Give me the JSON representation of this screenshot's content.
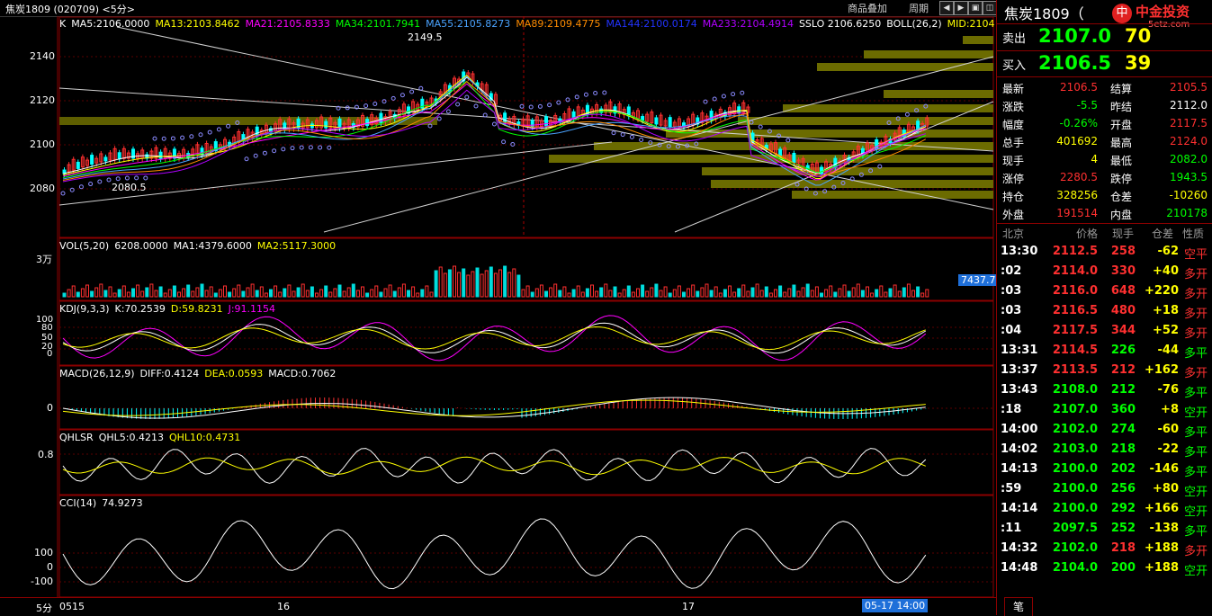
{
  "window": {
    "title": "焦炭1809 (020709) <5分>",
    "menu_overlay": "商品叠加",
    "menu_period": "周期"
  },
  "main_chart": {
    "indicator_line": [
      {
        "text": "K",
        "color": "#ffffff"
      },
      {
        "text": "MA5:2106.0000",
        "color": "#ffffff"
      },
      {
        "text": "MA13:2103.8462",
        "color": "#ffff00"
      },
      {
        "text": "MA21:2105.8333",
        "color": "#ff00ff"
      },
      {
        "text": "MA34:2101.7941",
        "color": "#00ff00"
      },
      {
        "text": "MA55:2105.8273",
        "color": "#4aa3ff"
      },
      {
        "text": "MA89:2109.4775",
        "color": "#ff8c00"
      },
      {
        "text": "MA144:2100.0174",
        "color": "#2233ff"
      },
      {
        "text": "MA233:2104.4914",
        "color": "#b000ff"
      },
      {
        "text": "SSLO 2106.6250",
        "color": "#ffffff"
      },
      {
        "text": "BOLL(26,2)",
        "color": "#ffffff"
      },
      {
        "text": "MID:2104",
        "color": "#ffff00"
      }
    ],
    "y_ticks": [
      "2140",
      "2120",
      "2100",
      "2080"
    ],
    "high_label": "2149.5",
    "low_label": "2080.5"
  },
  "volume_panel": {
    "title": "VOL(5,20)",
    "values": [
      {
        "text": "6208.0000",
        "color": "#ffffff"
      },
      {
        "text": "MA1:4379.6000",
        "color": "#ffffff"
      },
      {
        "text": "MA2:5117.3000",
        "color": "#ffff00"
      }
    ],
    "y_label": "3万",
    "badge": "7437.7"
  },
  "kdj_panel": {
    "title": "KDJ(9,3,3)",
    "values": [
      {
        "text": "K:70.2539",
        "color": "#ffffff"
      },
      {
        "text": "D:59.8231",
        "color": "#ffff00"
      },
      {
        "text": "J:91.1154",
        "color": "#ff00ff"
      }
    ],
    "y_ticks": [
      "100",
      "80",
      "50",
      "20",
      "0"
    ]
  },
  "macd_panel": {
    "title": "MACD(26,12,9)",
    "values": [
      {
        "text": "DIFF:0.4124",
        "color": "#ffffff"
      },
      {
        "text": "DEA:0.0593",
        "color": "#ffff00"
      },
      {
        "text": "MACD:0.7062",
        "color": "#ffffff"
      }
    ],
    "y_ticks": [
      "0"
    ]
  },
  "qhl_panel": {
    "title": "QHLSR",
    "values": [
      {
        "text": "QHL5:0.4213",
        "color": "#ffffff"
      },
      {
        "text": "QHL10:0.4731",
        "color": "#ffff00"
      }
    ],
    "y_ticks": [
      "0.8"
    ]
  },
  "cci_panel": {
    "title": "CCI(14)",
    "values": [
      {
        "text": "74.9273",
        "color": "#ffffff"
      }
    ],
    "y_ticks": [
      "100",
      "0",
      "-100"
    ]
  },
  "time_axis": {
    "period": "5分",
    "labels": [
      "0515",
      "16",
      "17"
    ],
    "cursor_label": "05-17 14:00"
  },
  "right_panel": {
    "title": "焦炭1809（",
    "logo_text": "中金投资",
    "logo_sub": "5etz.com",
    "ask": {
      "label": "卖出",
      "price": "2107.0",
      "vol": "70"
    },
    "bid": {
      "label": "买入",
      "price": "2106.5",
      "vol": "39"
    },
    "stats": [
      {
        "l1": "最新",
        "v1": "2106.5",
        "c1": "#ff3030",
        "l2": "结算",
        "v2": "2105.5",
        "c2": "#ff3030"
      },
      {
        "l1": "涨跌",
        "v1": "-5.5",
        "c1": "#00ff00",
        "l2": "昨结",
        "v2": "2112.0",
        "c2": "#ffffff"
      },
      {
        "l1": "幅度",
        "v1": "-0.26%",
        "c1": "#00ff00",
        "l2": "开盘",
        "v2": "2117.5",
        "c2": "#ff3030"
      },
      {
        "l1": "总手",
        "v1": "401692",
        "c1": "#ffff00",
        "l2": "最高",
        "v2": "2124.0",
        "c2": "#ff3030"
      },
      {
        "l1": "现手",
        "v1": "4",
        "c1": "#ffff00",
        "l2": "最低",
        "v2": "2082.0",
        "c2": "#00ff00"
      },
      {
        "l1": "涨停",
        "v1": "2280.5",
        "c1": "#ff3030",
        "l2": "跌停",
        "v2": "1943.5",
        "c2": "#00ff00"
      },
      {
        "l1": "持仓",
        "v1": "328256",
        "c1": "#ffff00",
        "l2": "仓差",
        "v2": "-10260",
        "c2": "#ffff00"
      },
      {
        "l1": "外盘",
        "v1": "191514",
        "c1": "#ff3030",
        "l2": "内盘",
        "v2": "210178",
        "c2": "#00ff00"
      }
    ],
    "trade_headers": [
      "北京",
      "价格",
      "现手",
      "仓差",
      "性质"
    ],
    "trades": [
      {
        "time": "13:30",
        "price": "2112.5",
        "pc": "#ff3030",
        "vol": "258",
        "vc": "#ff3030",
        "diff": "-62",
        "nature": "空平",
        "nc": "#ff3030"
      },
      {
        "time": ":02",
        "price": "2114.0",
        "pc": "#ff3030",
        "vol": "330",
        "vc": "#ff3030",
        "diff": "+40",
        "nature": "多开",
        "nc": "#ff3030"
      },
      {
        "time": ":03",
        "price": "2116.0",
        "pc": "#ff3030",
        "vol": "648",
        "vc": "#ff3030",
        "diff": "+220",
        "nature": "多开",
        "nc": "#ff3030"
      },
      {
        "time": ":03",
        "price": "2116.5",
        "pc": "#ff3030",
        "vol": "480",
        "vc": "#ff3030",
        "diff": "+18",
        "nature": "多开",
        "nc": "#ff3030"
      },
      {
        "time": ":04",
        "price": "2117.5",
        "pc": "#ff3030",
        "vol": "344",
        "vc": "#ff3030",
        "diff": "+52",
        "nature": "多开",
        "nc": "#ff3030"
      },
      {
        "time": "13:31",
        "price": "2114.5",
        "pc": "#ff3030",
        "vol": "226",
        "vc": "#00ff00",
        "diff": "-44",
        "nature": "多平",
        "nc": "#00ff00"
      },
      {
        "time": "13:37",
        "price": "2113.5",
        "pc": "#ff3030",
        "vol": "212",
        "vc": "#ff3030",
        "diff": "+162",
        "nature": "多开",
        "nc": "#ff3030"
      },
      {
        "time": "13:43",
        "price": "2108.0",
        "pc": "#00ff00",
        "vol": "212",
        "vc": "#00ff00",
        "diff": "-76",
        "nature": "多平",
        "nc": "#00ff00"
      },
      {
        "time": ":18",
        "price": "2107.0",
        "pc": "#00ff00",
        "vol": "360",
        "vc": "#00ff00",
        "diff": "+8",
        "nature": "空开",
        "nc": "#00ff00"
      },
      {
        "time": "14:00",
        "price": "2102.0",
        "pc": "#00ff00",
        "vol": "274",
        "vc": "#00ff00",
        "diff": "-60",
        "nature": "多平",
        "nc": "#00ff00"
      },
      {
        "time": "14:02",
        "price": "2103.0",
        "pc": "#00ff00",
        "vol": "218",
        "vc": "#00ff00",
        "diff": "-22",
        "nature": "多平",
        "nc": "#00ff00"
      },
      {
        "time": "14:13",
        "price": "2100.0",
        "pc": "#00ff00",
        "vol": "202",
        "vc": "#00ff00",
        "diff": "-146",
        "nature": "多平",
        "nc": "#00ff00"
      },
      {
        "time": ":59",
        "price": "2100.0",
        "pc": "#00ff00",
        "vol": "256",
        "vc": "#00ff00",
        "diff": "+80",
        "nature": "空开",
        "nc": "#00ff00"
      },
      {
        "time": "14:14",
        "price": "2100.0",
        "pc": "#00ff00",
        "vol": "292",
        "vc": "#00ff00",
        "diff": "+166",
        "nature": "空开",
        "nc": "#00ff00"
      },
      {
        "time": ":11",
        "price": "2097.5",
        "pc": "#00ff00",
        "vol": "252",
        "vc": "#00ff00",
        "diff": "-138",
        "nature": "多平",
        "nc": "#00ff00"
      },
      {
        "time": "14:32",
        "price": "2102.0",
        "pc": "#00ff00",
        "vol": "218",
        "vc": "#ff3030",
        "diff": "+188",
        "nature": "多开",
        "nc": "#ff3030"
      },
      {
        "time": "14:48",
        "price": "2104.0",
        "pc": "#00ff00",
        "vol": "200",
        "vc": "#00ff00",
        "diff": "+188",
        "nature": "空开",
        "nc": "#00ff00"
      }
    ],
    "tab_label": "笔"
  }
}
